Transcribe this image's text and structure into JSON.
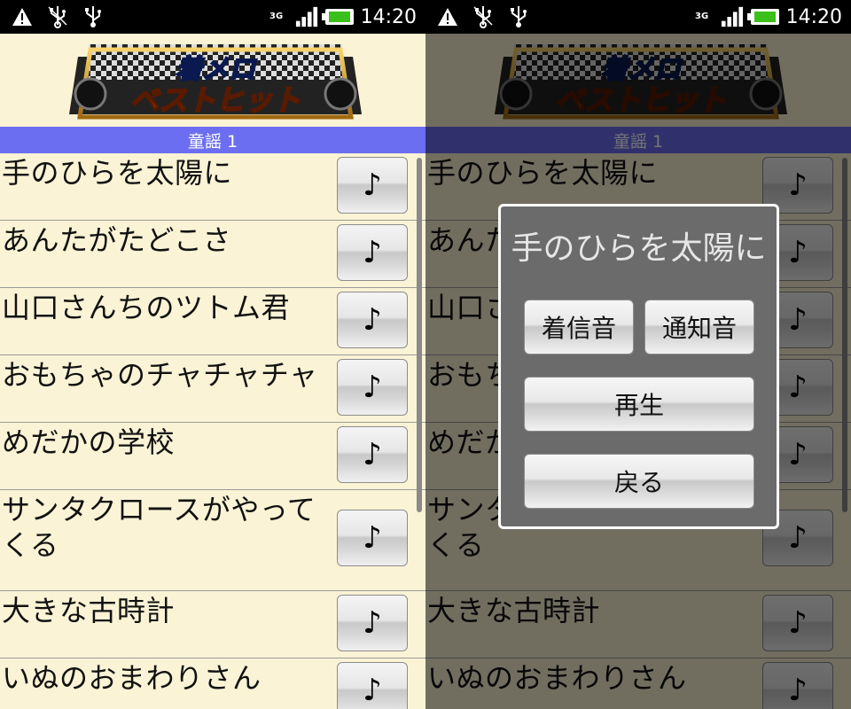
{
  "status_bar": {
    "time": "14:20",
    "network": "3G"
  },
  "banner": {
    "logo_line1": "着メロ",
    "logo_line2": "ベストヒット"
  },
  "category": {
    "title": "童謡 1"
  },
  "songs": [
    {
      "title": "手のひらを太陽に",
      "button": "♪"
    },
    {
      "title": "あんたがたどこさ",
      "button": "♪"
    },
    {
      "title": "山口さんちのツトム君",
      "button": "♪"
    },
    {
      "title": "おもちゃのチャチャチャ",
      "button": "♪"
    },
    {
      "title": "めだかの学校",
      "button": "♪"
    },
    {
      "title": "サンタクロースがやってくる",
      "button": "♪"
    },
    {
      "title": "大きな古時計",
      "button": "♪"
    },
    {
      "title": "いぬのおまわりさん",
      "button": "♪"
    }
  ],
  "dialog": {
    "title": "手のひらを太陽に",
    "ringtone_label": "着信音",
    "notification_label": "通知音",
    "play_label": "再生",
    "back_label": "戻る"
  }
}
